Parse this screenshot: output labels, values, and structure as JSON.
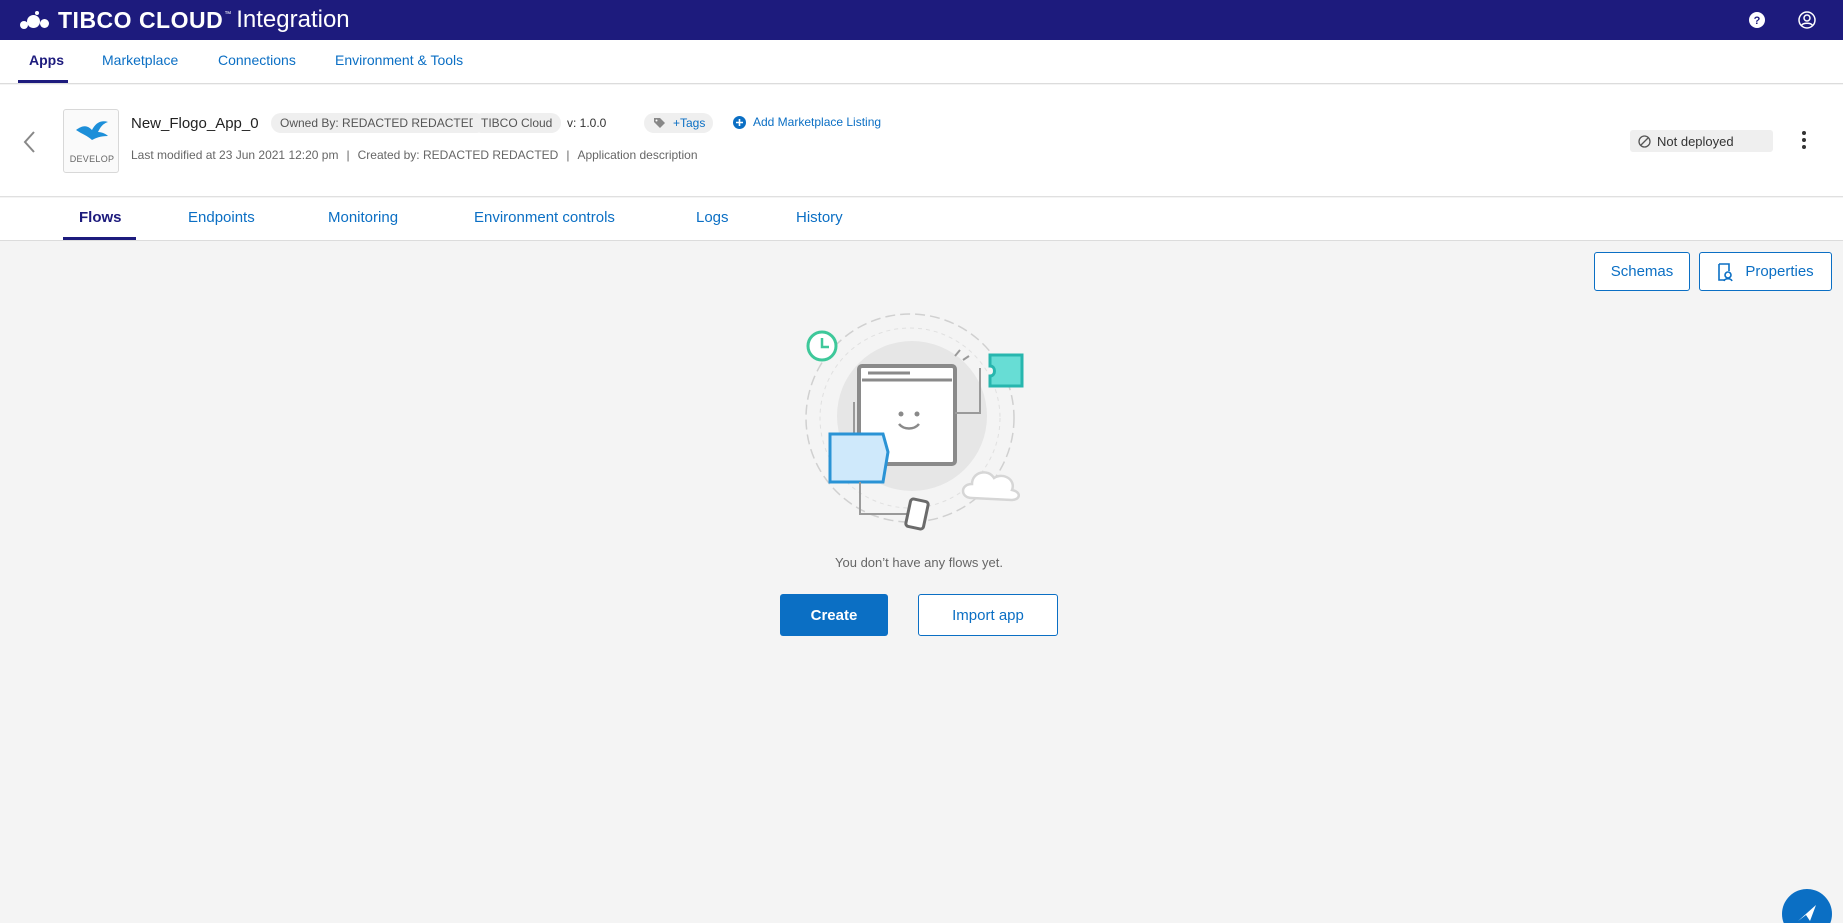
{
  "brand": {
    "name": "TIBCO CLOUD",
    "tm": "™",
    "product": "Integration"
  },
  "topbar": {
    "help_icon": "help-icon",
    "user_icon": "user-icon"
  },
  "mainnav": {
    "items": [
      {
        "label": "Apps",
        "active": true
      },
      {
        "label": "Marketplace"
      },
      {
        "label": "Connections"
      },
      {
        "label": "Environment & Tools"
      }
    ]
  },
  "app": {
    "name": "New_Flogo_App_0",
    "badge": "DEVELOP",
    "owner": "Owned By: REDACTED REDACTED",
    "platform": "TIBCO Cloud",
    "version": "v: 1.0.0",
    "tags": "+Tags",
    "add_listing": "Add Marketplace Listing",
    "last_modified": "Last modified at 23 Jun 2021 12:20 pm",
    "created_by": "Created by: REDACTED REDACTED",
    "description": "Application description",
    "status": "Not deployed"
  },
  "subtabs": {
    "items": [
      {
        "label": "Flows",
        "active": true
      },
      {
        "label": "Endpoints"
      },
      {
        "label": "Monitoring"
      },
      {
        "label": "Environment controls"
      },
      {
        "label": "Logs"
      },
      {
        "label": "History"
      }
    ]
  },
  "content": {
    "schemas_label": "Schemas",
    "properties_label": "Properties",
    "empty_message": "You don’t have any flows yet.",
    "create_label": "Create",
    "import_label": "Import app"
  },
  "colors": {
    "brand_bar": "#1d1b7d",
    "accent": "#0b6fc4",
    "background": "#f4f4f4"
  }
}
